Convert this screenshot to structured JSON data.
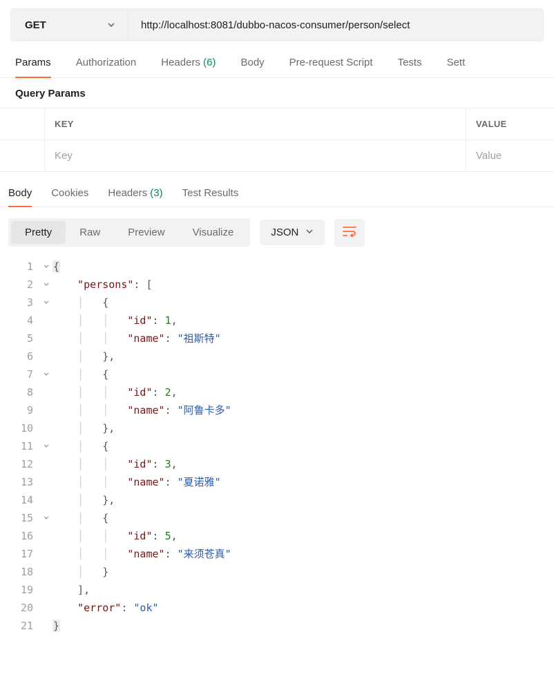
{
  "request": {
    "method": "GET",
    "url": "http://localhost:8081/dubbo-nacos-consumer/person/select"
  },
  "request_tabs": {
    "params": "Params",
    "authorization": "Authorization",
    "headers_label": "Headers",
    "headers_count": "(6)",
    "body": "Body",
    "prerequest": "Pre-request Script",
    "tests": "Tests",
    "settings": "Sett"
  },
  "query_params": {
    "heading": "Query Params",
    "headers": {
      "key": "KEY",
      "value": "VALUE"
    },
    "placeholders": {
      "key": "Key",
      "value": "Value"
    }
  },
  "response_tabs": {
    "body": "Body",
    "cookies": "Cookies",
    "headers_label": "Headers",
    "headers_count": "(3)",
    "test_results": "Test Results"
  },
  "response_toolbar": {
    "pretty": "Pretty",
    "raw": "Raw",
    "preview": "Preview",
    "visualize": "Visualize",
    "content_type": "JSON"
  },
  "response_body": {
    "persons": [
      {
        "id": 1,
        "name": "祖斯特"
      },
      {
        "id": 2,
        "name": "阿鲁卡多"
      },
      {
        "id": 3,
        "name": "夏诺雅"
      },
      {
        "id": 5,
        "name": "来须苍真"
      }
    ],
    "error": "ok"
  },
  "code_lines": [
    {
      "n": 1,
      "fold": true,
      "tokens": [
        {
          "t": "{",
          "c": "p box"
        }
      ]
    },
    {
      "n": 2,
      "fold": true,
      "tokens": [
        {
          "t": "    ",
          "c": ""
        },
        {
          "t": "\"persons\"",
          "c": "k"
        },
        {
          "t": ": [",
          "c": "p"
        }
      ]
    },
    {
      "n": 3,
      "fold": true,
      "tokens": [
        {
          "t": "    ",
          "c": ""
        },
        {
          "t": "│   ",
          "c": "guide"
        },
        {
          "t": "{",
          "c": "p"
        }
      ]
    },
    {
      "n": 4,
      "tokens": [
        {
          "t": "    ",
          "c": ""
        },
        {
          "t": "│   │   ",
          "c": "guide"
        },
        {
          "t": "\"id\"",
          "c": "k"
        },
        {
          "t": ": ",
          "c": "p"
        },
        {
          "t": "1",
          "c": "n"
        },
        {
          "t": ",",
          "c": "p"
        }
      ]
    },
    {
      "n": 5,
      "tokens": [
        {
          "t": "    ",
          "c": ""
        },
        {
          "t": "│   │   ",
          "c": "guide"
        },
        {
          "t": "\"name\"",
          "c": "k"
        },
        {
          "t": ": ",
          "c": "p"
        },
        {
          "t": "\"祖斯特\"",
          "c": "s"
        }
      ]
    },
    {
      "n": 6,
      "tokens": [
        {
          "t": "    ",
          "c": ""
        },
        {
          "t": "│   ",
          "c": "guide"
        },
        {
          "t": "},",
          "c": "p"
        }
      ]
    },
    {
      "n": 7,
      "fold": true,
      "tokens": [
        {
          "t": "    ",
          "c": ""
        },
        {
          "t": "│   ",
          "c": "guide"
        },
        {
          "t": "{",
          "c": "p"
        }
      ]
    },
    {
      "n": 8,
      "tokens": [
        {
          "t": "    ",
          "c": ""
        },
        {
          "t": "│   │   ",
          "c": "guide"
        },
        {
          "t": "\"id\"",
          "c": "k"
        },
        {
          "t": ": ",
          "c": "p"
        },
        {
          "t": "2",
          "c": "n"
        },
        {
          "t": ",",
          "c": "p"
        }
      ]
    },
    {
      "n": 9,
      "tokens": [
        {
          "t": "    ",
          "c": ""
        },
        {
          "t": "│   │   ",
          "c": "guide"
        },
        {
          "t": "\"name\"",
          "c": "k"
        },
        {
          "t": ": ",
          "c": "p"
        },
        {
          "t": "\"阿鲁卡多\"",
          "c": "s"
        }
      ]
    },
    {
      "n": 10,
      "tokens": [
        {
          "t": "    ",
          "c": ""
        },
        {
          "t": "│   ",
          "c": "guide"
        },
        {
          "t": "},",
          "c": "p"
        }
      ]
    },
    {
      "n": 11,
      "fold": true,
      "tokens": [
        {
          "t": "    ",
          "c": ""
        },
        {
          "t": "│   ",
          "c": "guide"
        },
        {
          "t": "{",
          "c": "p"
        }
      ]
    },
    {
      "n": 12,
      "tokens": [
        {
          "t": "    ",
          "c": ""
        },
        {
          "t": "│   │   ",
          "c": "guide"
        },
        {
          "t": "\"id\"",
          "c": "k"
        },
        {
          "t": ": ",
          "c": "p"
        },
        {
          "t": "3",
          "c": "n"
        },
        {
          "t": ",",
          "c": "p"
        }
      ]
    },
    {
      "n": 13,
      "tokens": [
        {
          "t": "    ",
          "c": ""
        },
        {
          "t": "│   │   ",
          "c": "guide"
        },
        {
          "t": "\"name\"",
          "c": "k"
        },
        {
          "t": ": ",
          "c": "p"
        },
        {
          "t": "\"夏诺雅\"",
          "c": "s"
        }
      ]
    },
    {
      "n": 14,
      "tokens": [
        {
          "t": "    ",
          "c": ""
        },
        {
          "t": "│   ",
          "c": "guide"
        },
        {
          "t": "},",
          "c": "p"
        }
      ]
    },
    {
      "n": 15,
      "fold": true,
      "tokens": [
        {
          "t": "    ",
          "c": ""
        },
        {
          "t": "│   ",
          "c": "guide"
        },
        {
          "t": "{",
          "c": "p"
        }
      ]
    },
    {
      "n": 16,
      "tokens": [
        {
          "t": "    ",
          "c": ""
        },
        {
          "t": "│   │   ",
          "c": "guide"
        },
        {
          "t": "\"id\"",
          "c": "k"
        },
        {
          "t": ": ",
          "c": "p"
        },
        {
          "t": "5",
          "c": "n"
        },
        {
          "t": ",",
          "c": "p"
        }
      ]
    },
    {
      "n": 17,
      "tokens": [
        {
          "t": "    ",
          "c": ""
        },
        {
          "t": "│   │   ",
          "c": "guide"
        },
        {
          "t": "\"name\"",
          "c": "k"
        },
        {
          "t": ": ",
          "c": "p"
        },
        {
          "t": "\"来须苍真\"",
          "c": "s"
        }
      ]
    },
    {
      "n": 18,
      "tokens": [
        {
          "t": "    ",
          "c": ""
        },
        {
          "t": "│   ",
          "c": "guide"
        },
        {
          "t": "}",
          "c": "p"
        }
      ]
    },
    {
      "n": 19,
      "tokens": [
        {
          "t": "    ",
          "c": ""
        },
        {
          "t": "],",
          "c": "p"
        }
      ]
    },
    {
      "n": 20,
      "tokens": [
        {
          "t": "    ",
          "c": ""
        },
        {
          "t": "\"error\"",
          "c": "k"
        },
        {
          "t": ": ",
          "c": "p"
        },
        {
          "t": "\"ok\"",
          "c": "s"
        }
      ]
    },
    {
      "n": 21,
      "tokens": [
        {
          "t": "}",
          "c": "p box"
        }
      ]
    }
  ]
}
